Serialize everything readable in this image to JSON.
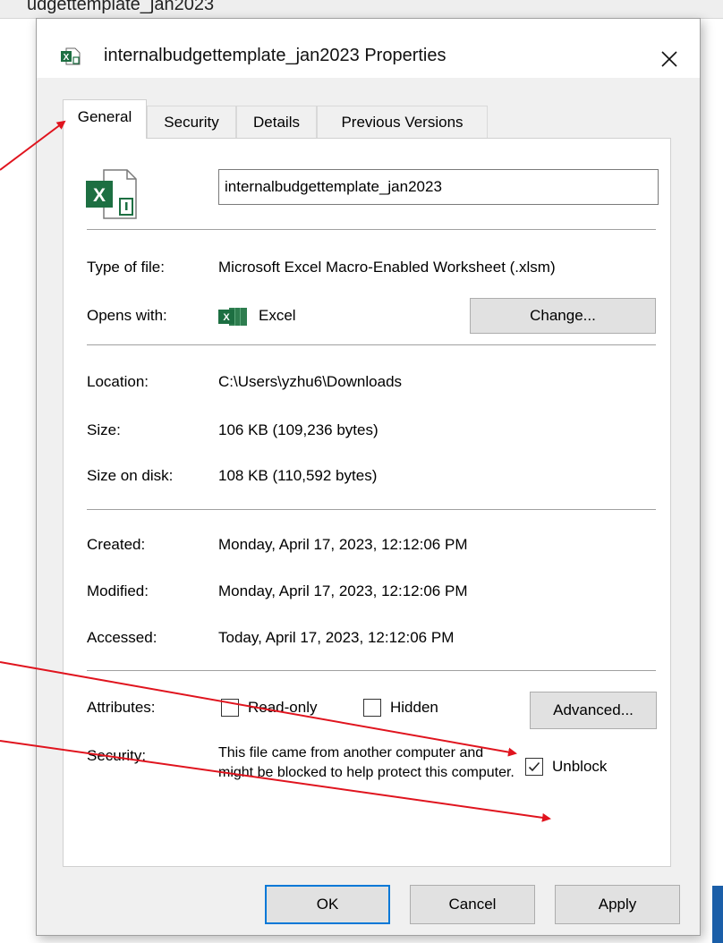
{
  "background_window": {
    "title": "udgettemplate_jan2023"
  },
  "dialog": {
    "title": "internalbudgettemplate_jan2023 Properties",
    "tabs": [
      {
        "label": "General",
        "active": true
      },
      {
        "label": "Security",
        "active": false
      },
      {
        "label": "Details",
        "active": false
      },
      {
        "label": "Previous Versions",
        "active": false
      }
    ],
    "file_name": "internalbudgettemplate_jan2023",
    "type_label": "Type of file:",
    "type_value": "Microsoft Excel Macro-Enabled Worksheet (.xlsm)",
    "opens_label": "Opens with:",
    "opens_value": "Excel",
    "change_button": "Change...",
    "location_label": "Location:",
    "location_value": "C:\\Users\\yzhu6\\Downloads",
    "size_label": "Size:",
    "size_value": "106 KB (109,236 bytes)",
    "size_disk_label": "Size on disk:",
    "size_disk_value": "108 KB (110,592 bytes)",
    "created_label": "Created:",
    "created_value": "Monday, April 17, 2023, 12:12:06 PM",
    "modified_label": "Modified:",
    "modified_value": "Monday, April 17, 2023, 12:12:06 PM",
    "accessed_label": "Accessed:",
    "accessed_value": "Today, April 17, 2023, 12:12:06 PM",
    "attributes_label": "Attributes:",
    "readonly_label": "Read-only",
    "readonly_checked": false,
    "hidden_label": "Hidden",
    "hidden_checked": false,
    "advanced_button": "Advanced...",
    "security_label": "Security:",
    "security_text": "This file came from another computer and might be blocked to help protect this computer.",
    "unblock_label": "Unblock",
    "unblock_checked": true,
    "ok_button": "OK",
    "cancel_button": "Cancel",
    "apply_button": "Apply"
  },
  "colors": {
    "dialog_bg": "#f0f0f0",
    "excel_green": "#1d6f42",
    "focus_blue": "#0078d7",
    "annotation_arrow": "#e0141e"
  },
  "icons": [
    "excel-file-icon",
    "close-icon",
    "excel-app-icon",
    "checkmark-icon"
  ]
}
